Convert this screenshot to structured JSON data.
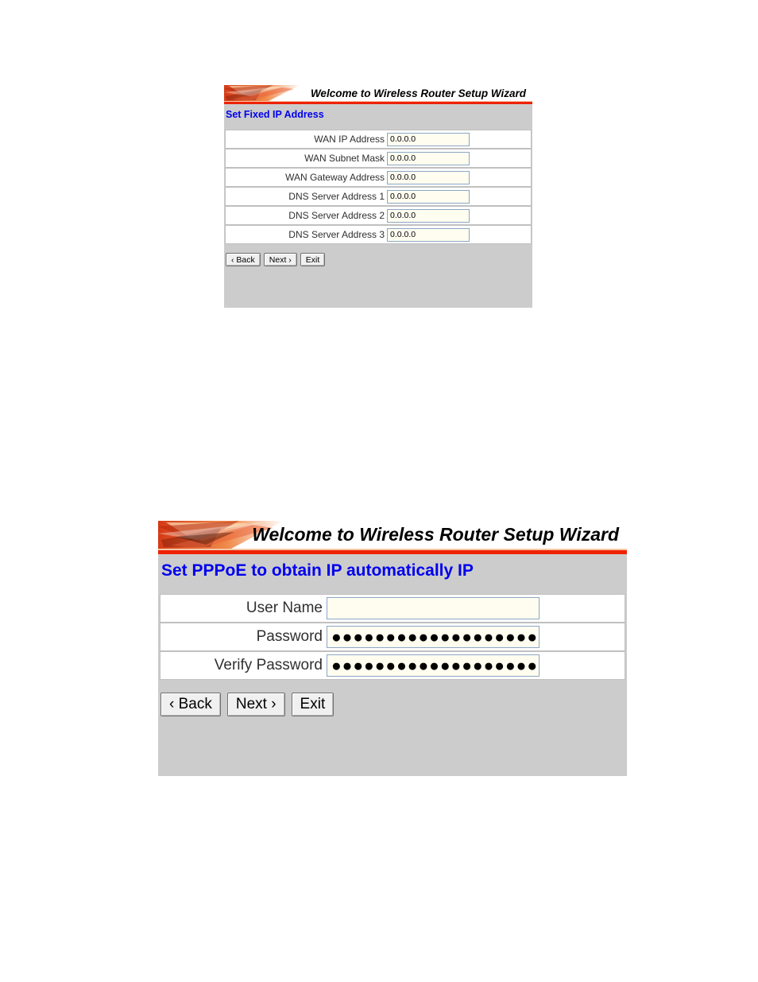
{
  "colors": {
    "panel_background": "#cccccc",
    "heading_blue": "#0000ee",
    "banner_rule_red": "#ee2200",
    "input_background": "#fffdf0",
    "input_border": "#8ba6c4"
  },
  "panels": [
    {
      "id": "fixed-ip",
      "banner_title": "Welcome to Wireless Router Setup Wizard",
      "banner_art_name": "red-starburst-banner-graphic",
      "section_title": "Set Fixed IP Address",
      "rows": [
        {
          "label": "WAN IP Address",
          "value": "0.0.0.0"
        },
        {
          "label": "WAN Subnet Mask",
          "value": "0.0.0.0"
        },
        {
          "label": "WAN Gateway Address",
          "value": "0.0.0.0"
        },
        {
          "label": "DNS Server Address 1",
          "value": "0.0.0.0"
        },
        {
          "label": "DNS Server Address 2",
          "value": "0.0.0.0"
        },
        {
          "label": "DNS Server Address 3",
          "value": "0.0.0.0"
        }
      ],
      "buttons": [
        {
          "name": "back-button",
          "label": "‹ Back"
        },
        {
          "name": "next-button",
          "label": "Next ›"
        },
        {
          "name": "exit-button",
          "label": "Exit"
        }
      ]
    },
    {
      "id": "pppoe",
      "banner_title": "Welcome to Wireless Router Setup Wizard",
      "banner_art_name": "red-starburst-banner-graphic",
      "section_title": "Set PPPoE to obtain IP automatically IP",
      "rows": [
        {
          "label": "User Name",
          "value": "",
          "placeholder": ""
        },
        {
          "label": "Password",
          "value": "●●●●●●●●●●●●●●●●●●●●●●●●"
        },
        {
          "label": "Verify Password",
          "value": "●●●●●●●●●●●●●●●●●●●●●●●●"
        }
      ],
      "buttons": [
        {
          "name": "back-button",
          "label": "‹ Back"
        },
        {
          "name": "next-button",
          "label": "Next ›"
        },
        {
          "name": "exit-button",
          "label": "Exit"
        }
      ]
    }
  ]
}
